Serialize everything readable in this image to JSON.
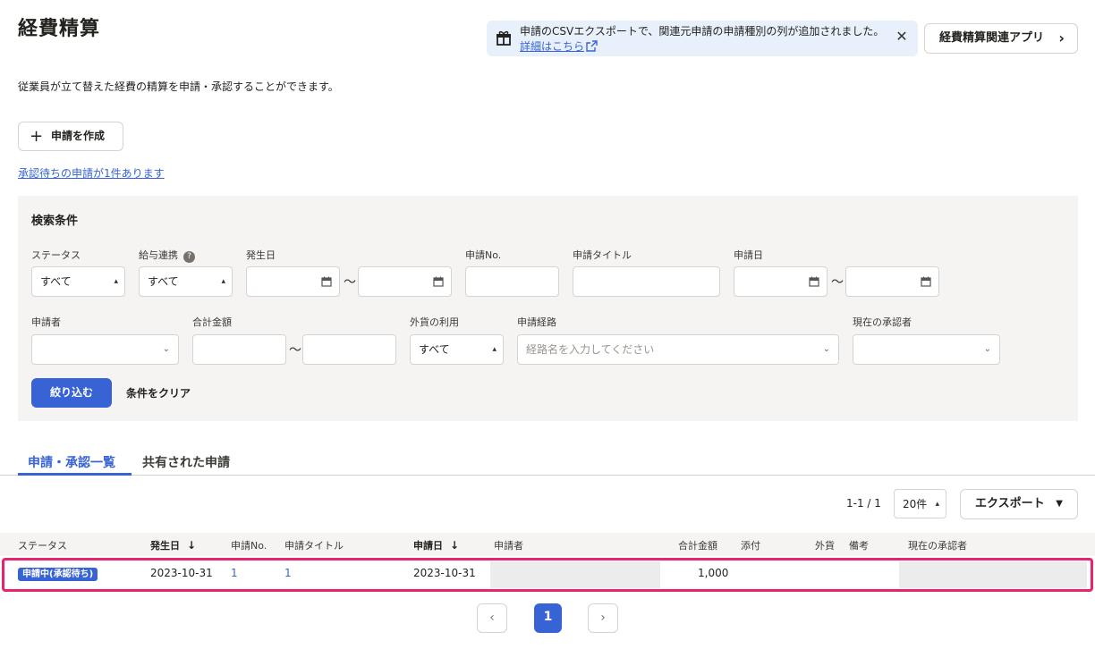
{
  "header": {
    "title": "経費精算",
    "description": "従業員が立て替えた経費の精算を申請・承認することができます。",
    "banner_message": "申請のCSVエクスポートで、関連元申請の申請種別の列が追加されました。",
    "banner_link": "詳細はこちら",
    "app_button": "経費精算関連アプリ"
  },
  "actions": {
    "create_button": "申請を作成",
    "pending_link": "承認待ちの申請が1件あります"
  },
  "search": {
    "title": "検索条件",
    "labels": {
      "status": "ステータス",
      "payroll": "給与連携",
      "occurrence_date": "発生日",
      "application_no": "申請No.",
      "application_title": "申請タイトル",
      "application_date": "申請日",
      "applicant": "申請者",
      "total_amount": "合計金額",
      "foreign_currency": "外貨の利用",
      "route": "申請経路",
      "current_approver": "現在の承認者"
    },
    "values": {
      "status": "すべて",
      "payroll": "すべて",
      "foreign_currency": "すべて"
    },
    "route_placeholder": "経路名を入力してください",
    "tilde": "〜",
    "filter_button": "絞り込む",
    "clear_button": "条件をクリア"
  },
  "tabs": [
    {
      "label": "申請・承認一覧"
    },
    {
      "label": "共有された申請"
    }
  ],
  "list": {
    "count": "1-1 / 1",
    "per_page": "20件",
    "export_button": "エクスポート",
    "columns": {
      "status": "ステータス",
      "occurrence_date": "発生日",
      "application_no": "申請No.",
      "title": "申請タイトル",
      "application_date": "申請日",
      "applicant": "申請者",
      "total_amount": "合計金額",
      "attachment": "添付",
      "foreign": "外貨",
      "remarks": "備考",
      "current_approver": "現在の承認者"
    },
    "rows": [
      {
        "status": "申請中(承認待ち)",
        "occurrence_date": "2023-10-31",
        "application_no": "1",
        "title": "1",
        "application_date": "2023-10-31",
        "total_amount": "1,000"
      }
    ]
  },
  "pagination": {
    "current": "1",
    "prev": "‹",
    "next": "›"
  },
  "colors": {
    "accent": "#3763d4",
    "highlight": "#e8246e",
    "panel": "#f5f4f2"
  }
}
